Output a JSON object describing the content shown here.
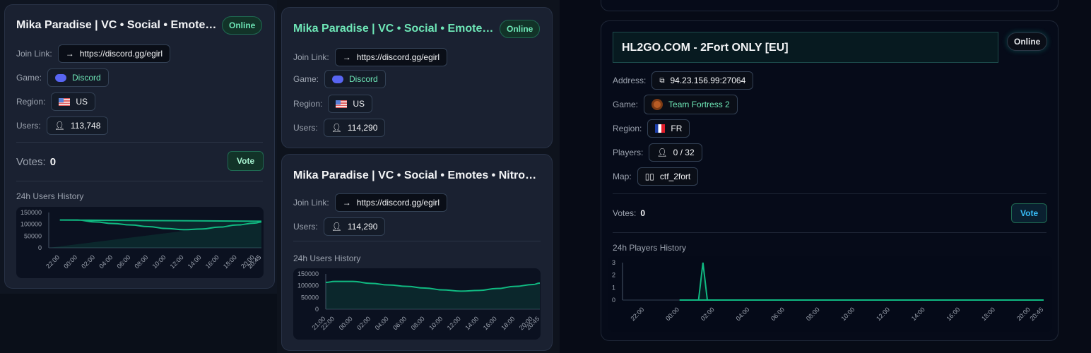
{
  "cards": [
    {
      "title": "Mika Paradise | VC • Social • Emotes • Nitro • Gaming",
      "status": "Online",
      "join_label": "Join Link:",
      "join_link": "https://discord.gg/egirl",
      "game_label": "Game:",
      "game": "Discord",
      "region_label": "Region:",
      "region": "US",
      "users_label": "Users:",
      "users": "113,748",
      "votes_label": "Votes:",
      "votes": "0",
      "vote_button": "Vote",
      "history_title": "24h Users History"
    },
    {
      "title": "Mika Paradise | VC • Social • Emotes • Nitro • Gaming",
      "status": "Online",
      "join_label": "Join Link:",
      "join_link": "https://discord.gg/egirl",
      "game_label": "Game:",
      "game": "Discord",
      "region_label": "Region:",
      "region": "US",
      "users_label": "Users:",
      "users": "114,290"
    },
    {
      "title": "Mika Paradise | VC • Social • Emotes • Nitro • Gaming",
      "join_label": "Join Link:",
      "join_link": "https://discord.gg/egirl",
      "users_label": "Users:",
      "users": "114,290",
      "history_title": "24h Users History"
    },
    {
      "title": "HL2GO.COM - 2Fort ONLY [EU]",
      "status": "Online",
      "address_label": "Address:",
      "address": "94.23.156.99:27064",
      "game_label": "Game:",
      "game": "Team Fortress 2",
      "region_label": "Region:",
      "region": "FR",
      "players_label": "Players:",
      "players": "0 / 32",
      "map_label": "Map:",
      "map": "ctf_2fort",
      "votes_label": "Votes:",
      "votes": "0",
      "vote_button": "Vote",
      "history_title": "24h Players History"
    }
  ],
  "colors": {
    "accent": "#10b981",
    "online": "#6ee7b7",
    "vote_blue": "#38bdf8"
  },
  "chart_data": [
    {
      "type": "area",
      "ylim": [
        0,
        150000
      ],
      "yticks": [
        0,
        50000,
        100000,
        150000
      ],
      "xticks": [
        "20:45",
        "22:00",
        "00:00",
        "02:00",
        "04:00",
        "06:00",
        "08:00",
        "10:00",
        "12:00",
        "14:00",
        "16:00",
        "18:00",
        "20:00",
        "20:45"
      ],
      "x": [
        "20:45",
        "22:00",
        "00:00",
        "02:00",
        "04:00",
        "06:00",
        "08:00",
        "10:00",
        "12:00",
        "14:00",
        "16:00",
        "18:00",
        "20:00",
        "20:45"
      ],
      "values": [
        113000,
        118000,
        118000,
        110000,
        103000,
        97000,
        90000,
        82000,
        77000,
        80000,
        88000,
        97000,
        105000,
        110000
      ]
    },
    {
      "type": "area",
      "ylim": [
        0,
        150000
      ],
      "yticks": [
        0,
        50000,
        100000,
        150000
      ],
      "xticks": [
        "21:00",
        "22:00",
        "00:00",
        "02:00",
        "04:00",
        "06:00",
        "08:00",
        "10:00",
        "12:00",
        "14:00",
        "16:00",
        "18:00",
        "20:00",
        "20:45"
      ],
      "x": [
        "21:00",
        "22:00",
        "00:00",
        "02:00",
        "04:00",
        "06:00",
        "08:00",
        "10:00",
        "12:00",
        "14:00",
        "16:00",
        "18:00",
        "20:00",
        "20:45"
      ],
      "values": [
        114000,
        118000,
        118000,
        110000,
        103000,
        97000,
        90000,
        82000,
        77000,
        80000,
        88000,
        97000,
        105000,
        111000
      ]
    },
    {
      "type": "line",
      "ylim": [
        0,
        3
      ],
      "yticks": [
        0,
        1,
        2,
        3
      ],
      "xticks": [
        "20:45",
        "22:00",
        "00:00",
        "02:00",
        "04:00",
        "06:00",
        "08:00",
        "10:00",
        "12:00",
        "14:00",
        "16:00",
        "18:00",
        "20:00"
      ],
      "x": [
        "20:45",
        "00:00",
        "01:05",
        "01:20",
        "01:35",
        "20:45"
      ],
      "values": [
        0,
        0,
        0,
        3,
        0,
        0
      ]
    }
  ]
}
